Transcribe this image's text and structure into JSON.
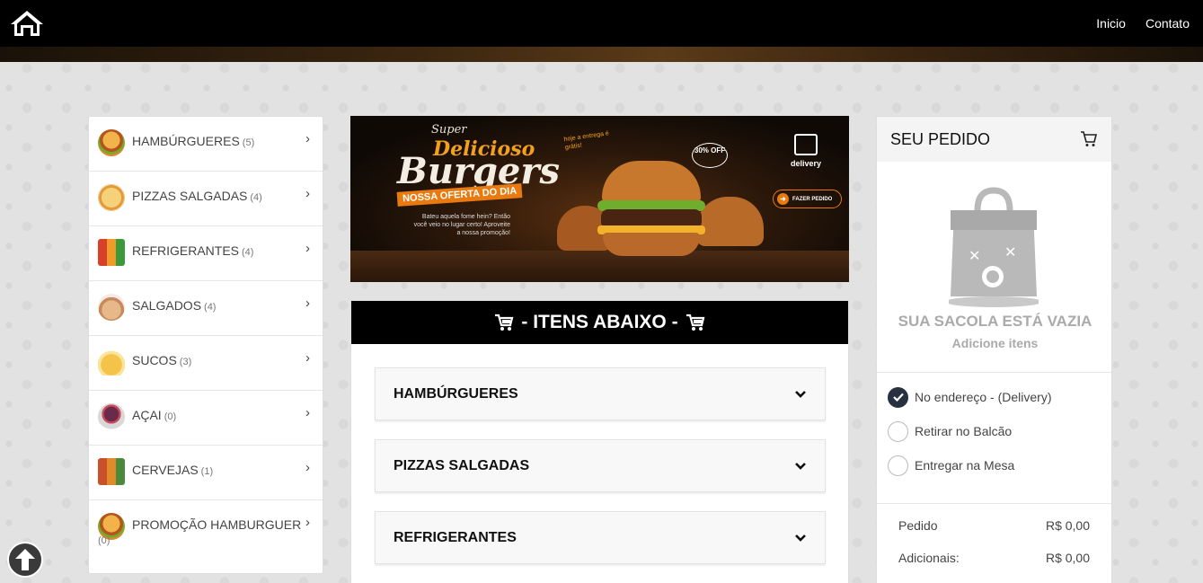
{
  "header": {
    "home_icon": "home-icon",
    "nav": [
      {
        "label": "Inicio"
      },
      {
        "label": "Contato"
      }
    ]
  },
  "categories": [
    {
      "label": "HAMBÚRGUERES",
      "count": "(5)",
      "icon": "burger-icon",
      "color": "#e08a2a"
    },
    {
      "label": "PIZZAS SALGADAS",
      "count": "(4)",
      "icon": "pizza-icon",
      "color": "#f2c36b"
    },
    {
      "label": "REFRIGERANTES",
      "count": "(4)",
      "icon": "soda-bottles-icon",
      "color": "#d9402a"
    },
    {
      "label": "SALGADOS",
      "count": "(4)",
      "icon": "snacks-icon",
      "color": "#e7b98a"
    },
    {
      "label": "SUCOS",
      "count": "(3)",
      "icon": "juice-icon",
      "color": "#f4c44a"
    },
    {
      "label": "AÇAI",
      "count": "(0)",
      "icon": "acai-bowl-icon",
      "color": "#6a2a4a"
    },
    {
      "label": "CERVEJAS",
      "count": "(1)",
      "icon": "beer-bottles-icon",
      "color": "#c9502a"
    },
    {
      "label": "PROMOÇÃO HAMBURGUER",
      "count": "(0)",
      "icon": "burger-icon",
      "color": "#e08a2a"
    }
  ],
  "banner": {
    "line1": "Super",
    "line2": "Delicioso",
    "line3": "Burgers",
    "ribbon": "NOSSA OFERTA DO DIA",
    "tagline": "Bateu aquela fome hein? Então você veio no lugar certo! Aproveite a nossa promoção!",
    "delivery_note": "hoje a entrega é grátis!",
    "discount": "30% OFF",
    "delivery_label": "delivery",
    "cta": "FAZER PEDIDO"
  },
  "items": {
    "header": "- ITENS ABAIXO -",
    "sections": [
      {
        "label": "HAMBÚRGUERES"
      },
      {
        "label": "PIZZAS SALGADAS"
      },
      {
        "label": "REFRIGERANTES"
      }
    ]
  },
  "order": {
    "title": "SEU PEDIDO",
    "empty_line1": "SUA SACOLA ESTÁ VAZIA",
    "empty_line2": "Adicione itens",
    "options": [
      {
        "label": "No endereço - (Delivery)",
        "selected": true
      },
      {
        "label": "Retirar no Balcão",
        "selected": false
      },
      {
        "label": "Entregar na Mesa",
        "selected": false
      }
    ],
    "totals": [
      {
        "label": "Pedido",
        "value": "R$ 0,00"
      },
      {
        "label": "Adicionais:",
        "value": "R$ 0,00"
      }
    ]
  },
  "colors": {
    "topbar": "#000000",
    "accent": "#27313f",
    "banner_orange": "#f3a11c"
  }
}
